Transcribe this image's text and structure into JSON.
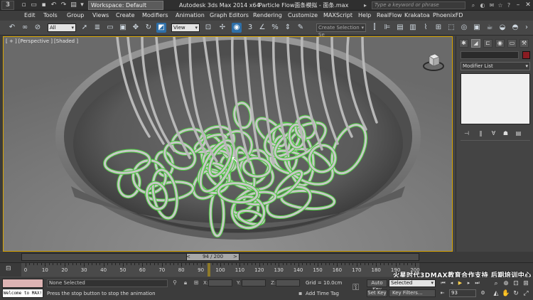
{
  "window": {
    "workspace_label": "Workspace: Default",
    "app_title": "Autodesk 3ds Max  2014 x64",
    "file_title": "Particle Flow面条模拟 - 面条.max",
    "search_placeholder": "Type a keyword or phrase"
  },
  "menu": {
    "items": [
      "Edit",
      "Tools",
      "Group",
      "Views",
      "Create",
      "Modifiers",
      "Animation",
      "Graph Editors",
      "Rendering",
      "Customize",
      "MAXScript",
      "Help",
      "RealFlow",
      "Krakatoa",
      "PhoenixFD"
    ]
  },
  "toolbar": {
    "selection_filter": "All",
    "reference_coord": "View",
    "snap_number": "3",
    "selection_set": "Create Selection Se"
  },
  "viewport": {
    "labels": [
      "[ + ]",
      "[Perspective ]",
      "[Shaded ]"
    ],
    "background_color": "#808080",
    "noodle_color": "#c8c8c8",
    "highlight_color": "#49c63c"
  },
  "command_panel": {
    "tabs": [
      "create-icon",
      "modify-icon",
      "hierarchy-icon",
      "motion-icon",
      "display-icon",
      "utilities-icon"
    ],
    "modifier_list": "Modifier List",
    "object_color": "#8a1c22"
  },
  "time_slider": {
    "current_frame": 94,
    "total_frames": 200,
    "label": "94 / 200"
  },
  "track_bar": {
    "ticks": [
      "0",
      "10",
      "20",
      "30",
      "40",
      "50",
      "60",
      "70",
      "80",
      "90",
      "100",
      "110",
      "120",
      "130",
      "140",
      "150",
      "160",
      "170",
      "180",
      "190",
      "200"
    ],
    "watermark": "火星时代3DMAX教育合作支持 后期培训中心"
  },
  "status": {
    "maxscript_listener": "",
    "welcome": "Welcome to MAX!",
    "selection": "None Selected",
    "prompt": "Press the stop button to stop the animation",
    "coord_x_label": "X:",
    "coord_y_label": "Y:",
    "coord_z_label": "Z:",
    "grid": "Grid = 10.0cm",
    "add_time_tag": "Add Time Tag",
    "auto_key": "Auto Key",
    "set_key": "Set Key",
    "selected_mode": "Selected",
    "key_filters": "Key Filters...",
    "frame_value": "93"
  }
}
